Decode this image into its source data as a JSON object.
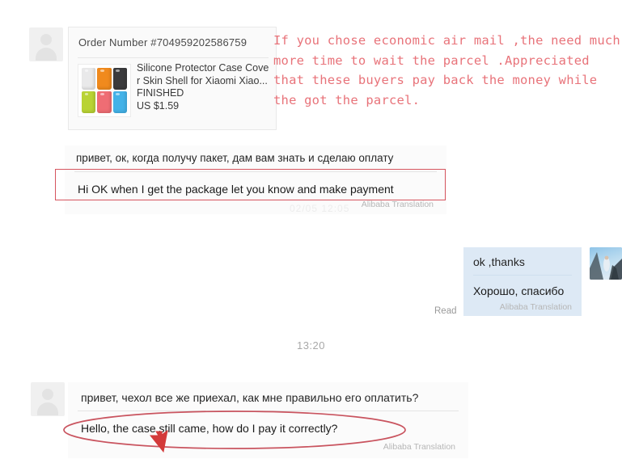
{
  "order_card": {
    "order_number_label": "Order Number #704959202586759",
    "product_title_line1": "Silicone Protector Case Cove",
    "product_title_line2": "r Skin Shell for Xiaomi Xiao...",
    "status": "FINISHED",
    "price": "US $1.59",
    "thumbnail_colors": [
      "#e9e9ea",
      "#f08a1d",
      "#3a3a3c",
      "#b9d334",
      "#ef6d74",
      "#43b2e8"
    ]
  },
  "annotation": {
    "note_line1": "If you chose economic air mail ,the need much",
    "note_line2": "more time to wait the parcel .Appreciated",
    "note_line3": "that these buyers pay back the money while",
    "note_line4": "the got the parcel.",
    "note_color": "#e8737a",
    "highlight_color": "#d6555f"
  },
  "messages": [
    {
      "id": "msg-russian-1",
      "direction": "incoming",
      "original": "привет, ок, когда получу пакет, дам вам знать и сделаю оплату",
      "translation": "Hi OK when I get the package let you know and make payment",
      "translation_label": "Alibaba Translation"
    },
    {
      "id": "msg-ok-thanks",
      "direction": "outgoing",
      "original": "ok ,thanks",
      "translation": "Хорошо, спасибо",
      "translation_label": "Alibaba Translation",
      "read_status": "Read"
    },
    {
      "id": "msg-russian-2",
      "direction": "incoming",
      "original": "привет, чехол все же приехал, как мне правильно его оплатить?",
      "translation": "Hello, the case still came, how do I pay it correctly?",
      "translation_label": "Alibaba Translation"
    }
  ],
  "timestamps": {
    "faded_clipped": "02/05  12:05",
    "center": "13:20"
  }
}
